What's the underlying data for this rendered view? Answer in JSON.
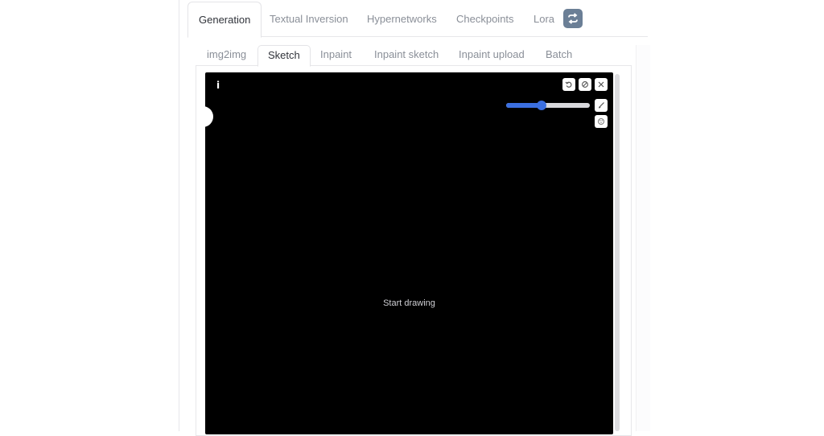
{
  "top_tabs": {
    "items": [
      {
        "label": "Generation"
      },
      {
        "label": "Textual Inversion"
      },
      {
        "label": "Hypernetworks"
      },
      {
        "label": "Checkpoints"
      },
      {
        "label": "Lora"
      }
    ],
    "active": "Generation",
    "refresh_icon": "refresh-icon"
  },
  "sub_tabs": {
    "items": [
      {
        "label": "img2img"
      },
      {
        "label": "Sketch"
      },
      {
        "label": "Inpaint"
      },
      {
        "label": "Inpaint sketch"
      },
      {
        "label": "Inpaint upload"
      },
      {
        "label": "Batch"
      }
    ],
    "active": "Sketch"
  },
  "canvas": {
    "info_label": "i",
    "placeholder": "Start drawing",
    "brush_size_fraction": 0.42,
    "icons": {
      "undo": "undo-icon",
      "clear": "clear-icon",
      "close": "close-icon",
      "brush": "brush-icon",
      "color": "color-palette-icon"
    }
  },
  "colors": {
    "accent": "#3b6fe0",
    "refresh_button": "#6b7f96",
    "canvas_bg": "#000000"
  }
}
